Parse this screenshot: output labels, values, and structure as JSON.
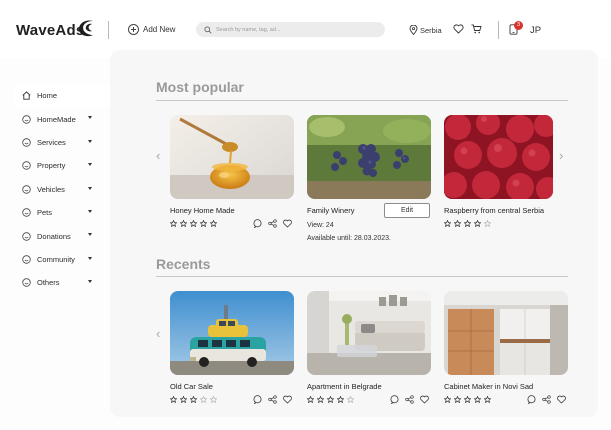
{
  "header": {
    "brand": "WaveAds",
    "add_new_label": "Add New",
    "search_placeholder": "Search by name, tag, ad...",
    "location": "Serbia",
    "notification_count": "3",
    "user_initials": "JP"
  },
  "sidebar": {
    "items": [
      {
        "label": "Home",
        "icon": "home-icon",
        "active": true
      },
      {
        "label": "HomeMade",
        "icon": "smiley-icon",
        "dropdown": true
      },
      {
        "label": "Services",
        "icon": "smiley-icon",
        "dropdown": true
      },
      {
        "label": "Property",
        "icon": "smiley-icon",
        "dropdown": true
      },
      {
        "label": "Vehicles",
        "icon": "smiley-icon",
        "dropdown": true
      },
      {
        "label": "Pets",
        "icon": "smiley-icon",
        "dropdown": true
      },
      {
        "label": "Donations",
        "icon": "smiley-icon",
        "dropdown": true
      },
      {
        "label": "Community",
        "icon": "smiley-icon",
        "dropdown": true
      },
      {
        "label": "Others",
        "icon": "smiley-icon",
        "dropdown": true
      }
    ]
  },
  "most_popular": {
    "title": "Most popular",
    "cards": [
      {
        "title": "Honey Home Made",
        "rating": 5,
        "image": "honey-jar-photo"
      },
      {
        "title": "Family Winery",
        "image": "grapes-vineyard-photo",
        "views": "View: 24",
        "available_label": "Available until:",
        "available_date": "28.03.2023.",
        "edit_label": "Edit"
      },
      {
        "title": "Raspberry from central Serbia",
        "rating": 4,
        "image": "raspberries-photo"
      }
    ]
  },
  "recents": {
    "title": "Recents",
    "cards": [
      {
        "title": "Old Car Sale",
        "rating": 3,
        "image": "vintage-bus-with-car-photo"
      },
      {
        "title": "Apartment in Belgrade",
        "rating": 4,
        "image": "living-room-photo"
      },
      {
        "title": "Cabinet Maker in Novi Sad",
        "rating": 5,
        "image": "kitchen-cabinets-photo"
      }
    ]
  },
  "colors": {
    "accent_badge": "#d9342b",
    "section_title": "#9a9a9a",
    "panel": "#f7f7f7"
  }
}
